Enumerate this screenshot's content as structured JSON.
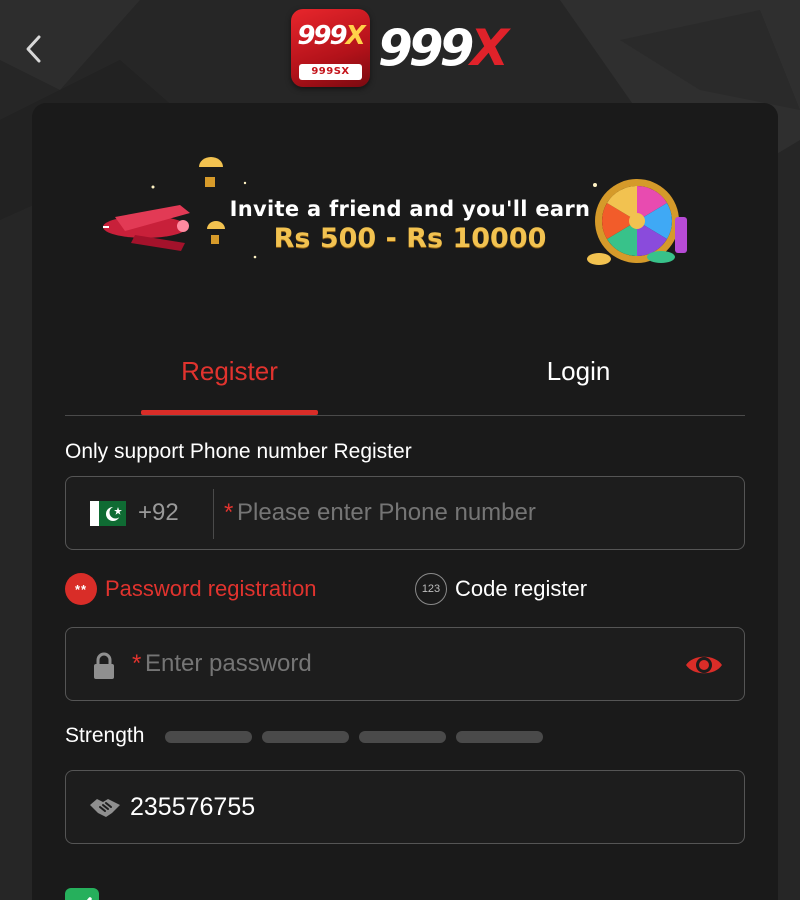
{
  "header": {
    "back_icon": "chevron-left-icon",
    "logo_badge_mark": "999",
    "logo_badge_x": "X",
    "logo_badge_sub": "999SX",
    "logo_word": "999",
    "logo_word_x": "X"
  },
  "banner": {
    "line1": "Invite a friend and you'll earn",
    "line2": "Rs 500 - Rs 10000"
  },
  "tabs": [
    {
      "label": "Register",
      "active": true
    },
    {
      "label": "Login",
      "active": false
    }
  ],
  "form": {
    "note": "Only support Phone number Register",
    "phone": {
      "country_flag": "pakistan-flag-icon",
      "dial_code": "+92",
      "required_mark": "*",
      "placeholder": "Please enter Phone number"
    },
    "modes": [
      {
        "icon_text": "**",
        "label": "Password registration",
        "active": true
      },
      {
        "icon_text": "123",
        "label": "Code register",
        "active": false
      }
    ],
    "password": {
      "required_mark": "*",
      "placeholder": "Enter password",
      "lock_icon": "lock-icon",
      "toggle_icon": "eye-icon"
    },
    "strength": {
      "label": "Strength",
      "level": 0,
      "segments": 4
    },
    "invite": {
      "icon": "handshake-icon",
      "value": "235576755"
    },
    "agree": {
      "checked": true
    }
  },
  "colors": {
    "accent": "#d92d28",
    "background": "#262626",
    "card": "#1a1a1a",
    "checkbox": "#26b05c",
    "gold": "#f2c250"
  }
}
